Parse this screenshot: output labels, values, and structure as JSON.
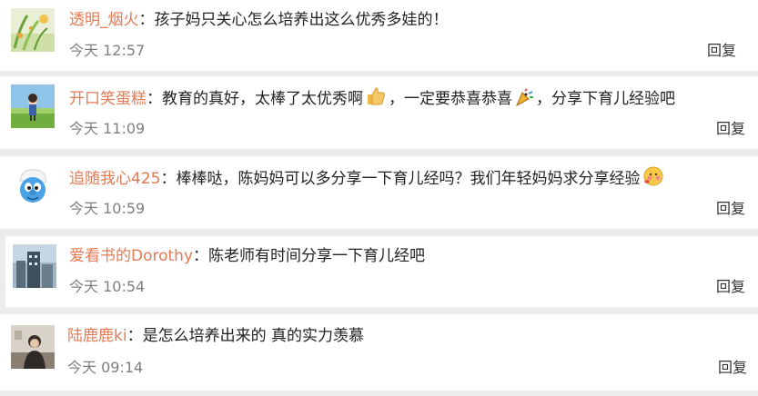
{
  "comments": [
    {
      "username": "透明_烟火",
      "colon": "：",
      "text": "孩子妈只关心怎么培养出这么优秀多娃的！",
      "time": "今天 12:57",
      "reply_label": "回复",
      "avatar_icon": "landscape-avatar"
    },
    {
      "username": "开口笑蛋糕",
      "colon": "：",
      "text_parts": [
        "教育的真好，太棒了太优秀啊",
        "，一定要恭喜恭喜",
        "，分享下育儿经验吧"
      ],
      "emojis": [
        "thumbs-up-icon",
        "celebration-popper-icon"
      ],
      "time": "今天 11:09",
      "reply_label": "回复",
      "avatar_icon": "anime-field-avatar"
    },
    {
      "username": "追随我心425",
      "colon": "：",
      "text": "棒棒哒，陈妈妈可以多分享一下育儿经吗？我们年轻妈妈求分享经验",
      "emojis": [
        "shy-face-icon"
      ],
      "time": "今天 10:59",
      "reply_label": "回复",
      "avatar_icon": "smurf-avatar"
    },
    {
      "username": "爱看书的Dorothy",
      "colon": "：",
      "text": "陈老师有时间分享一下育儿经吧",
      "time": "今天 10:54",
      "reply_label": "回复",
      "avatar_icon": "city-building-avatar"
    },
    {
      "username": "陆鹿鹿ki",
      "colon": "：",
      "text": "是怎么培养出来的 真的实力羡慕",
      "time": "今天 09:14",
      "reply_label": "回复",
      "avatar_icon": "person-photo-avatar"
    }
  ],
  "colors": {
    "background": "#ececec",
    "card": "#ffffff",
    "username": "#e57a52",
    "time": "#7f7f7f",
    "text": "#222222"
  }
}
